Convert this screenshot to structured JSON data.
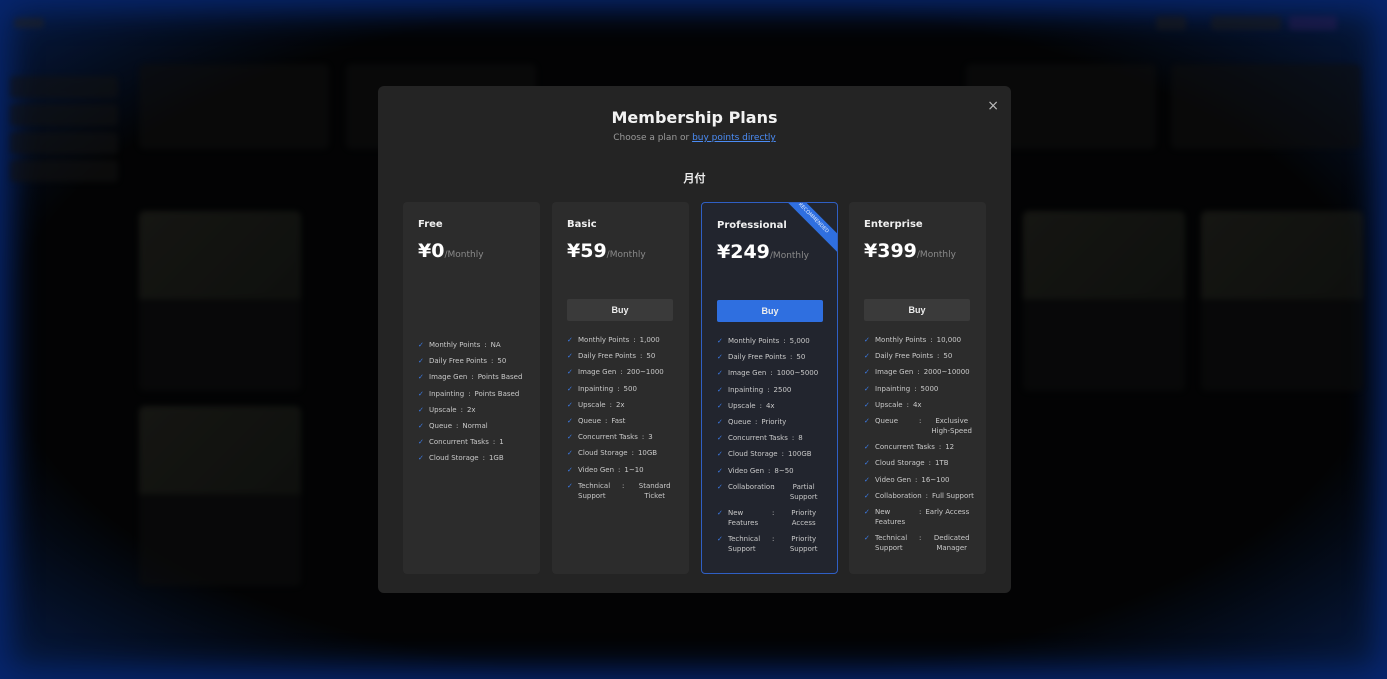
{
  "modal": {
    "title": "Membership Plans",
    "subtitle_prefix": "Choose a plan or ",
    "subtitle_link": "buy points directly",
    "period": "月付",
    "close_glyph": "×"
  },
  "plans": [
    {
      "name": "Free",
      "price": "¥0",
      "unit": "/Monthly",
      "buy": "",
      "features": [
        [
          "Monthly Points",
          "NA"
        ],
        [
          "Daily Free Points",
          "50"
        ],
        [
          "Image Gen",
          "Points Based"
        ],
        [
          "Inpainting",
          "Points Based"
        ],
        [
          "Upscale",
          "2x"
        ],
        [
          "Queue",
          "Normal"
        ],
        [
          "Concurrent Tasks",
          "1"
        ],
        [
          "Cloud Storage",
          "1GB"
        ]
      ]
    },
    {
      "name": "Basic",
      "price": "¥59",
      "unit": "/Monthly",
      "buy": "Buy",
      "features": [
        [
          "Monthly Points",
          "1,000"
        ],
        [
          "Daily Free Points",
          "50"
        ],
        [
          "Image Gen",
          "200~1000"
        ],
        [
          "Inpainting",
          "500"
        ],
        [
          "Upscale",
          "2x"
        ],
        [
          "Queue",
          "Fast"
        ],
        [
          "Concurrent Tasks",
          "3"
        ],
        [
          "Cloud Storage",
          "10GB"
        ],
        [
          "Video Gen",
          "1~10"
        ],
        [
          "Technical Support",
          "Standard Ticket"
        ]
      ]
    },
    {
      "name": "Professional",
      "price": "¥249",
      "unit": "/Monthly",
      "buy": "Buy",
      "ribbon": "RECOMMENDED",
      "features": [
        [
          "Monthly Points",
          "5,000"
        ],
        [
          "Daily Free Points",
          "50"
        ],
        [
          "Image Gen",
          "1000~5000"
        ],
        [
          "Inpainting",
          "2500"
        ],
        [
          "Upscale",
          "4x"
        ],
        [
          "Queue",
          "Priority"
        ],
        [
          "Concurrent Tasks",
          "8"
        ],
        [
          "Cloud Storage",
          "100GB"
        ],
        [
          "Video Gen",
          "8~50"
        ],
        [
          "Collaboration",
          "Partial Support"
        ],
        [
          "New Features",
          "Priority Access"
        ],
        [
          "Technical Support",
          "Priority Support"
        ]
      ]
    },
    {
      "name": "Enterprise",
      "price": "¥399",
      "unit": "/Monthly",
      "buy": "Buy",
      "features": [
        [
          "Monthly Points",
          "10,000"
        ],
        [
          "Daily Free Points",
          "50"
        ],
        [
          "Image Gen",
          "2000~10000"
        ],
        [
          "Inpainting",
          "5000"
        ],
        [
          "Upscale",
          "4x"
        ],
        [
          "Queue",
          "Exclusive High-Speed"
        ],
        [
          "Concurrent Tasks",
          "12"
        ],
        [
          "Cloud Storage",
          "1TB"
        ],
        [
          "Video Gen",
          "16~100"
        ],
        [
          "Collaboration",
          "Full Support"
        ],
        [
          "New Features",
          "Early Access"
        ],
        [
          "Technical Support",
          "Dedicated Manager"
        ]
      ]
    }
  ],
  "colors": {
    "accent": "#2f6fe0",
    "check": "#3b7be8",
    "modal_bg": "#242424"
  }
}
